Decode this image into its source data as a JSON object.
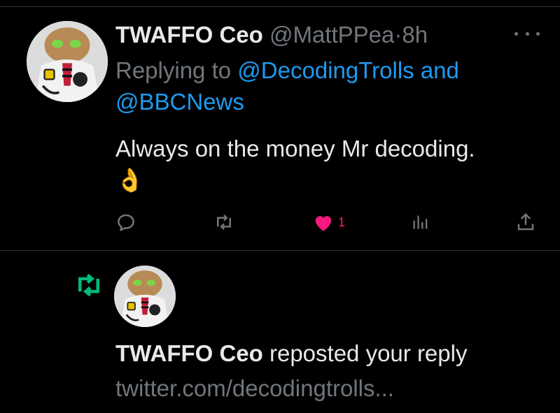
{
  "tweet": {
    "display_name": "TWAFFO Ceo",
    "handle": "@MattPPea",
    "separator": "·",
    "time": "8h",
    "replying_prefix": "Replying to",
    "mention_1": "@DecodingTrolls",
    "and_word": "and",
    "mention_2": "@BBCNews",
    "body": "Always on the money Mr decoding.",
    "emoji": "👌",
    "actions": {
      "reply_icon": "reply-icon",
      "retweet_icon": "retweet-icon",
      "like_icon": "heart-icon",
      "like_count": "1",
      "views_icon": "analytics-icon",
      "share_icon": "share-icon"
    }
  },
  "notification": {
    "display_name": "TWAFFO Ceo",
    "action_text": "reposted your reply",
    "link_text": "twitter.com/decodingtrolls..."
  },
  "colors": {
    "background": "#000000",
    "text": "#e7e9ea",
    "muted": "#71767b",
    "link": "#1d9bf0",
    "like": "#f91880",
    "repost": "#00ba7c"
  }
}
